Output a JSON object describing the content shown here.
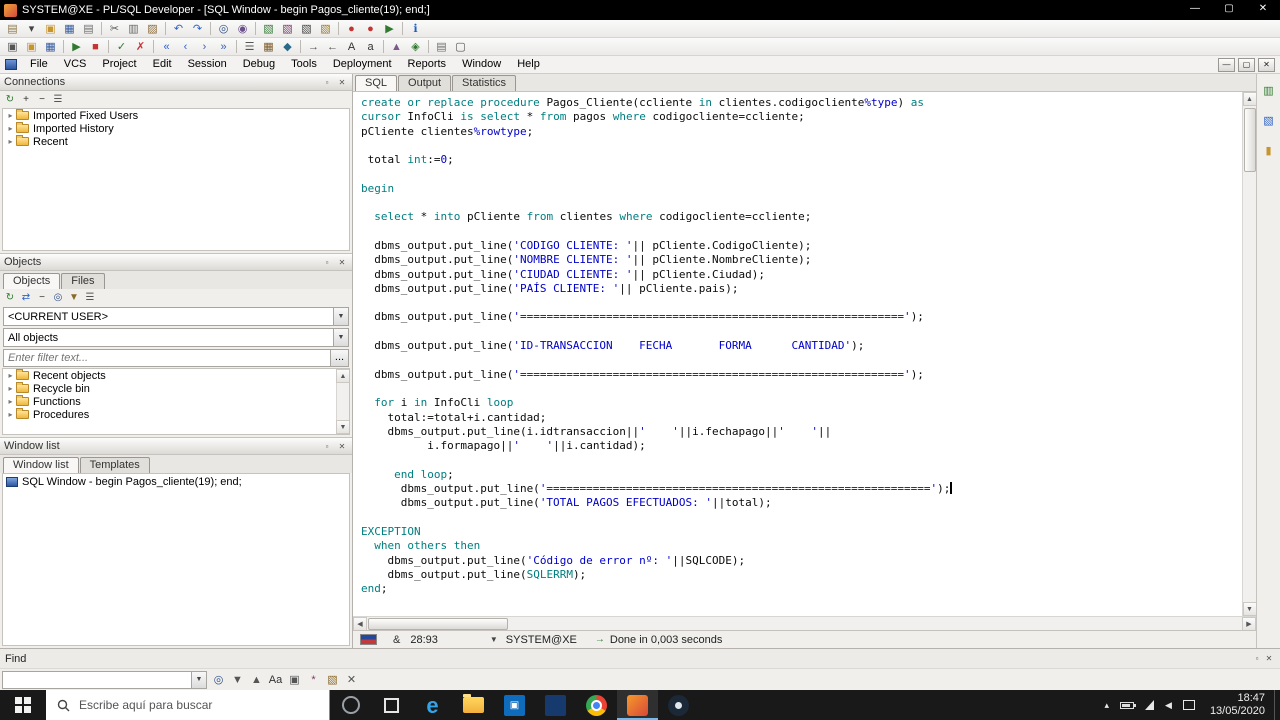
{
  "title_bar": {
    "title": "SYSTEM@XE - PL/SQL Developer - [SQL Window - begin Pagos_cliente(19); end;]"
  },
  "menu": {
    "items": [
      "File",
      "VCS",
      "Project",
      "Edit",
      "Session",
      "Debug",
      "Tools",
      "Deployment",
      "Reports",
      "Window",
      "Help"
    ]
  },
  "toolbars": {
    "row1": [
      {
        "n": "new-document-icon",
        "g": "▤",
        "c": "#8c7a4a"
      },
      {
        "n": "new-dropdown-icon",
        "g": "▾",
        "c": "#444444"
      },
      {
        "n": "open-icon",
        "g": "▣",
        "c": "#c8952d"
      },
      {
        "n": "save-icon",
        "g": "▦",
        "c": "#33589e"
      },
      {
        "n": "print-icon",
        "g": "▤",
        "c": "#6f6f6f"
      },
      {
        "sep": 1
      },
      {
        "n": "cut-icon",
        "g": "✂",
        "c": "#555555"
      },
      {
        "n": "copy-icon",
        "g": "▥",
        "c": "#666666"
      },
      {
        "n": "paste-icon",
        "g": "▨",
        "c": "#8a6a3a"
      },
      {
        "sep": 1
      },
      {
        "n": "undo-icon",
        "g": "↶",
        "c": "#2f62c4"
      },
      {
        "n": "redo-icon",
        "g": "↷",
        "c": "#2f62c4"
      },
      {
        "sep": 1
      },
      {
        "n": "find-icon",
        "g": "◎",
        "c": "#2f4f8a"
      },
      {
        "n": "replace-icon",
        "g": "◉",
        "c": "#6a4f8a"
      },
      {
        "sep": 1
      },
      {
        "n": "new-sql-window-icon",
        "g": "▧",
        "c": "#3a7a3a"
      },
      {
        "n": "new-report-window-icon",
        "g": "▧",
        "c": "#7a3a6a"
      },
      {
        "n": "new-command-window-icon",
        "g": "▧",
        "c": "#444444"
      },
      {
        "n": "new-test-window-icon",
        "g": "▧",
        "c": "#9a7a2a"
      },
      {
        "sep": 1
      },
      {
        "n": "macro-record-icon",
        "g": "●",
        "c": "#c43434"
      },
      {
        "n": "macro-stop-icon",
        "g": "●",
        "c": "#c43434"
      },
      {
        "n": "macro-play-icon",
        "g": "▶",
        "c": "#2f7a2f"
      },
      {
        "sep": 1
      },
      {
        "n": "help-info-icon",
        "g": "ℹ",
        "c": "#1b5fc4"
      }
    ],
    "row2": [
      {
        "n": "session-window-icon",
        "g": "▣",
        "c": "#555555"
      },
      {
        "n": "open-file-icon",
        "g": "▣",
        "c": "#c8952d"
      },
      {
        "n": "save-file-icon",
        "g": "▦",
        "c": "#33589e"
      },
      {
        "sep": 1
      },
      {
        "n": "execute-icon",
        "g": "▶",
        "c": "#2f7a2f"
      },
      {
        "n": "break-icon",
        "g": "■",
        "c": "#c43434"
      },
      {
        "sep": 1
      },
      {
        "n": "commit-icon",
        "g": "✓",
        "c": "#2f7a2f"
      },
      {
        "n": "rollback-icon",
        "g": "✗",
        "c": "#c43434"
      },
      {
        "sep": 1
      },
      {
        "n": "first-record-icon",
        "g": "«",
        "c": "#2f62c4"
      },
      {
        "n": "prior-record-icon",
        "g": "‹",
        "c": "#2f62c4"
      },
      {
        "n": "next-record-icon",
        "g": "›",
        "c": "#2f62c4"
      },
      {
        "n": "last-record-icon",
        "g": "»",
        "c": "#2f62c4"
      },
      {
        "sep": 1
      },
      {
        "n": "describe-icon",
        "g": "☰",
        "c": "#555555"
      },
      {
        "n": "query-builder-icon",
        "g": "▦",
        "c": "#7a5a2a"
      },
      {
        "n": "explain-plan-icon",
        "g": "◆",
        "c": "#2a6a8a"
      },
      {
        "sep": 1
      },
      {
        "n": "indent-icon",
        "g": "→",
        "c": "#555555"
      },
      {
        "n": "unindent-icon",
        "g": "←",
        "c": "#555555"
      },
      {
        "n": "uppercase-icon",
        "g": "A",
        "c": "#333333"
      },
      {
        "n": "lowercase-icon",
        "g": "a",
        "c": "#333333"
      },
      {
        "sep": 1
      },
      {
        "n": "compile-icon",
        "g": "▲",
        "c": "#7a5a8a"
      },
      {
        "n": "debug-icon",
        "g": "◈",
        "c": "#2f7a2f"
      },
      {
        "sep": 1
      },
      {
        "n": "print-preview-icon",
        "g": "▤",
        "c": "#6f6f6f"
      },
      {
        "n": "layout-icon",
        "g": "▢",
        "c": "#555555"
      }
    ]
  },
  "connections": {
    "title": "Connections",
    "tools": [
      {
        "n": "refresh-icon",
        "g": "↻",
        "c": "#2f7a2f"
      },
      {
        "n": "expand-node-icon",
        "g": "+",
        "c": "#333333"
      },
      {
        "n": "collapse-node-icon",
        "g": "−",
        "c": "#333333"
      },
      {
        "n": "connections-settings-icon",
        "g": "☰",
        "c": "#555555"
      }
    ],
    "items": [
      "Imported Fixed Users",
      "Imported History",
      "Recent"
    ]
  },
  "objects": {
    "title": "Objects",
    "tabs": [
      "Objects",
      "Files"
    ],
    "tools": [
      {
        "n": "refresh-icon",
        "g": "↻",
        "c": "#2f7a2f"
      },
      {
        "n": "sync-selection-icon",
        "g": "⇄",
        "c": "#2f62c4"
      },
      {
        "n": "collapse-all-icon",
        "g": "−",
        "c": "#333333"
      },
      {
        "n": "find-object-icon",
        "g": "◎",
        "c": "#2f4f8a"
      },
      {
        "n": "filter-icon",
        "g": "▼",
        "c": "#8a6a2a"
      },
      {
        "n": "objects-settings-icon",
        "g": "☰",
        "c": "#555555"
      }
    ],
    "user_dropdown": "<CURRENT USER>",
    "filter_dropdown": "All objects",
    "filter_placeholder": "Enter filter text...",
    "more_button": "...",
    "tree": [
      "Recent objects",
      "Recycle bin",
      "Functions",
      "Procedures"
    ]
  },
  "window_list": {
    "title": "Window list",
    "tabs": [
      "Window list",
      "Templates"
    ],
    "items": [
      "SQL Window - begin Pagos_cliente(19); end;"
    ]
  },
  "editor": {
    "tabs": [
      "SQL",
      "Output",
      "Statistics"
    ]
  },
  "right_strip": {
    "tools": [
      {
        "n": "split-editor-icon",
        "g": "▥",
        "c": "#2f7a2f"
      },
      {
        "n": "highlight-icon",
        "g": "▧",
        "c": "#2f62c4"
      },
      {
        "n": "bookmark-icon",
        "g": "▮",
        "c": "#c8952d"
      }
    ]
  },
  "status": {
    "modified": "&",
    "position": "28:93",
    "connection": "SYSTEM@XE",
    "message": "Done in 0,003 seconds"
  },
  "find_bar": {
    "label": "Find"
  },
  "find_toolbar": {
    "value": "",
    "tools": [
      {
        "n": "find-next-icon",
        "g": "◎",
        "c": "#2f4f8a"
      },
      {
        "n": "search-down-icon",
        "g": "▼",
        "c": "#555555"
      },
      {
        "n": "search-up-icon",
        "g": "▲",
        "c": "#555555"
      },
      {
        "n": "match-case-icon",
        "g": "Aa",
        "c": "#333333"
      },
      {
        "n": "whole-word-icon",
        "g": "▣",
        "c": "#555555"
      },
      {
        "n": "regex-icon",
        "g": "*",
        "c": "#7a3a6a"
      },
      {
        "n": "highlight-all-icon",
        "g": "▧",
        "c": "#8a6a2a"
      },
      {
        "n": "close-find-icon",
        "g": "✕",
        "c": "#555555"
      }
    ]
  },
  "taskbar": {
    "search_placeholder": "Escribe aquí para buscar",
    "apps": [
      {
        "n": "cortana-icon",
        "cls": "ti-cortana"
      },
      {
        "n": "task-view-icon",
        "cls": "ti-taskview"
      },
      {
        "n": "edge-icon",
        "cls": "ti-edge",
        "g": "e"
      },
      {
        "n": "file-explorer-icon",
        "cls": "ti-explorer"
      },
      {
        "n": "store-icon",
        "cls": "ti-store",
        "g": "▣"
      },
      {
        "n": "app-icon",
        "cls": "ti-app"
      },
      {
        "n": "chrome-icon",
        "cls": "ti-chrome"
      },
      {
        "n": "plsql-developer-icon",
        "cls": "ti-plsql",
        "active": true
      },
      {
        "n": "steam-icon",
        "cls": "ti-steam"
      }
    ],
    "tray": [
      {
        "n": "hidden-icons-chevron-icon",
        "g": "▴"
      },
      {
        "n": "battery-icon",
        "cls": "tri-battery"
      },
      {
        "n": "network-icon",
        "cls": "tri-wifi"
      },
      {
        "n": "volume-icon",
        "g": "◀"
      },
      {
        "n": "action-center-icon",
        "cls": "tri-ac"
      }
    ],
    "time": "18:47",
    "date": "13/05/2020"
  },
  "code": {
    "lines": [
      [
        [
          "k",
          "create or replace procedure "
        ],
        [
          "p",
          "Pagos_Cliente(ccliente "
        ],
        [
          "k",
          "in "
        ],
        [
          "p",
          "clientes.codigocliente"
        ],
        [
          "s",
          "%type"
        ],
        [
          "p",
          ") "
        ],
        [
          "k",
          "as"
        ]
      ],
      [
        [
          "k",
          "cursor "
        ],
        [
          "p",
          "InfoCli "
        ],
        [
          "k",
          "is select "
        ],
        [
          "p",
          "* "
        ],
        [
          "k",
          "from "
        ],
        [
          "p",
          "pagos "
        ],
        [
          "k",
          "where "
        ],
        [
          "p",
          "codigocliente=ccliente;"
        ]
      ],
      [
        [
          "p",
          "pCliente clientes"
        ],
        [
          "s",
          "%rowtype"
        ],
        [
          "p",
          ";"
        ]
      ],
      [],
      [
        [
          "p",
          " total "
        ],
        [
          "k",
          "int"
        ],
        [
          "p",
          ":="
        ],
        [
          "n",
          "0"
        ],
        [
          "p",
          ";"
        ]
      ],
      [],
      [
        [
          "k",
          "begin"
        ]
      ],
      [],
      [
        [
          "p",
          "  "
        ],
        [
          "k",
          "select "
        ],
        [
          "p",
          "* "
        ],
        [
          "k",
          "into "
        ],
        [
          "p",
          "pCliente "
        ],
        [
          "k",
          "from "
        ],
        [
          "p",
          "clientes "
        ],
        [
          "k",
          "where "
        ],
        [
          "p",
          "codigocliente=ccliente;"
        ]
      ],
      [],
      [
        [
          "p",
          "  dbms_output.put_line("
        ],
        [
          "s",
          "'CODIGO CLIENTE: '"
        ],
        [
          "p",
          "|| pCliente.CodigoCliente);"
        ]
      ],
      [
        [
          "p",
          "  dbms_output.put_line("
        ],
        [
          "s",
          "'NOMBRE CLIENTE: '"
        ],
        [
          "p",
          "|| pCliente.NombreCliente);"
        ]
      ],
      [
        [
          "p",
          "  dbms_output.put_line("
        ],
        [
          "s",
          "'CIUDAD CLIENTE: '"
        ],
        [
          "p",
          "|| pCliente.Ciudad);"
        ]
      ],
      [
        [
          "p",
          "  dbms_output.put_line("
        ],
        [
          "s",
          "'PAÍS CLIENTE: '"
        ],
        [
          "p",
          "|| pCliente.pais);"
        ]
      ],
      [],
      [
        [
          "p",
          "  dbms_output.put_line("
        ],
        [
          "s",
          "'=========================================================='"
        ],
        [
          "p",
          ");"
        ]
      ],
      [],
      [
        [
          "p",
          "  dbms_output.put_line("
        ],
        [
          "s",
          "'ID-TRANSACCION    FECHA       FORMA      CANTIDAD'"
        ],
        [
          "p",
          ");"
        ]
      ],
      [],
      [
        [
          "p",
          "  dbms_output.put_line("
        ],
        [
          "s",
          "'=========================================================='"
        ],
        [
          "p",
          ");"
        ]
      ],
      [],
      [
        [
          "p",
          "  "
        ],
        [
          "k",
          "for "
        ],
        [
          "p",
          "i "
        ],
        [
          "k",
          "in "
        ],
        [
          "p",
          "InfoCli "
        ],
        [
          "k",
          "loop"
        ]
      ],
      [
        [
          "p",
          "    total:=total+i.cantidad;"
        ]
      ],
      [
        [
          "p",
          "    dbms_output.put_line(i.idtransaccion||"
        ],
        [
          "s",
          "'    '"
        ],
        [
          "p",
          "||i.fechapago||"
        ],
        [
          "s",
          "'    '"
        ],
        [
          "p",
          "||"
        ]
      ],
      [
        [
          "p",
          "          i.formapago||"
        ],
        [
          "s",
          "'    '"
        ],
        [
          "p",
          "||i.cantidad);"
        ]
      ],
      [],
      [
        [
          "p",
          "     "
        ],
        [
          "k",
          "end loop"
        ],
        [
          "p",
          ";"
        ]
      ],
      [
        [
          "p",
          "      dbms_output.put_line("
        ],
        [
          "s",
          "'=========================================================='"
        ],
        [
          "p",
          ");"
        ],
        [
          "caret",
          ""
        ]
      ],
      [
        [
          "p",
          "      dbms_output.put_line("
        ],
        [
          "s",
          "'TOTAL PAGOS EFECTUADOS: '"
        ],
        [
          "p",
          "||total);"
        ]
      ],
      [],
      [
        [
          "k",
          "EXCEPTION"
        ]
      ],
      [
        [
          "p",
          "  "
        ],
        [
          "k",
          "when others then"
        ]
      ],
      [
        [
          "p",
          "    dbms_output.put_line("
        ],
        [
          "s",
          "'Código de error nº: '"
        ],
        [
          "p",
          "||SQLCODE);"
        ]
      ],
      [
        [
          "p",
          "    dbms_output.put_line("
        ],
        [
          "k",
          "SQLERRM"
        ],
        [
          "p",
          ");"
        ]
      ],
      [
        [
          "k",
          "end"
        ],
        [
          "p",
          ";"
        ]
      ]
    ]
  }
}
